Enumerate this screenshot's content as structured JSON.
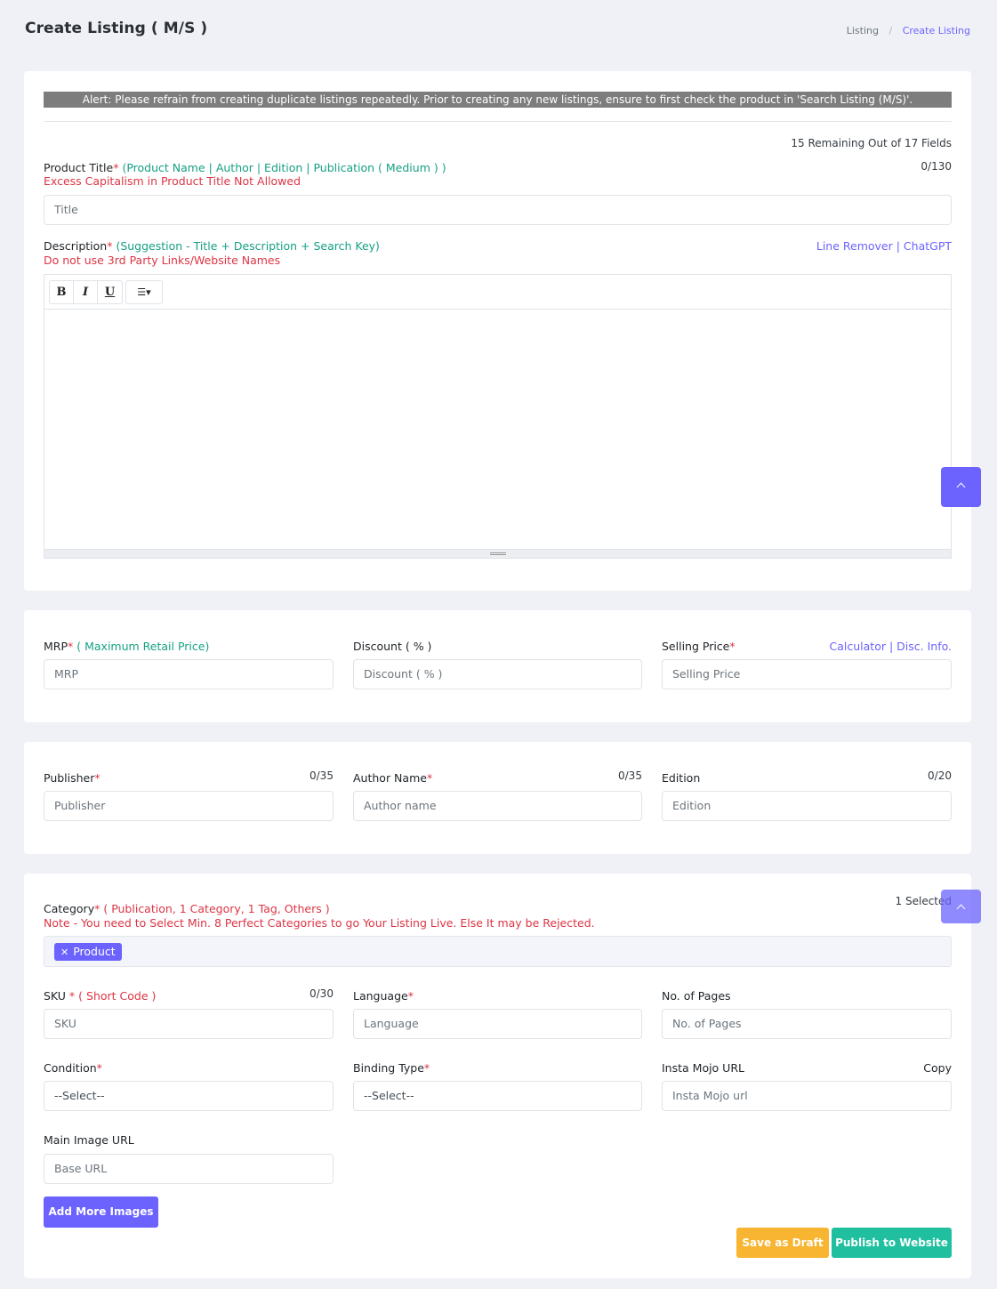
{
  "header": {
    "title": "Create Listing ( M/S )",
    "breadcrumb": [
      "Listing",
      "Create Listing"
    ]
  },
  "alert": "Alert: Please refrain from creating duplicate listings repeatedly. Prior to creating any new listings, ensure to first check the product in 'Search Listing (M/S)'.",
  "fields_remaining": "15 Remaining Out of 17 Fields",
  "product_title": {
    "label": "Product Title",
    "hint": "(Product Name | Author | Edition | Publication ( Medium ) )",
    "warning": "Excess Capitalism in Product Title Not Allowed",
    "counter": "0/130",
    "placeholder": "Title"
  },
  "description": {
    "label": "Description",
    "hint": "(Suggestion - Title + Description + Search Key)",
    "warning": "Do not use 3rd Party Links/Website Names",
    "links": "Line Remover | ChatGPT",
    "toolbar": {
      "bold": "B",
      "italic": "I",
      "underline": "U",
      "list": "☰▾"
    }
  },
  "pricing": {
    "mrp_label": "MRP",
    "mrp_hint": "( Maximum Retail Price)",
    "mrp_placeholder": "MRP",
    "discount_label": "Discount ( % )",
    "discount_placeholder": "Discount ( % )",
    "selling_label": "Selling Price",
    "selling_placeholder": "Selling Price",
    "links": "Calculator | Disc. Info."
  },
  "publisher": {
    "publisher_label": "Publisher",
    "publisher_counter": "0/35",
    "publisher_placeholder": "Publisher",
    "author_label": "Author Name",
    "author_counter": "0/35",
    "author_placeholder": "Author name",
    "edition_label": "Edition",
    "edition_counter": "0/20",
    "edition_placeholder": "Edition"
  },
  "category": {
    "label": "Category",
    "hint": "( Publication, 1 Category, 1 Tag, Others )",
    "note": "Note - You need to Select Min. 8 Perfect Categories to go Your Listing Live. Else It may be Rejected.",
    "selected": "1 Selected",
    "tags": [
      "Product"
    ]
  },
  "details": {
    "sku_label": "SKU ",
    "sku_hint": "( Short Code )",
    "sku_counter": "0/30",
    "sku_placeholder": "SKU",
    "language_label": "Language",
    "language_placeholder": "Language",
    "pages_label": "No. of Pages",
    "pages_placeholder": "No. of Pages",
    "condition_label": "Condition",
    "condition_value": "--Select--",
    "binding_label": "Binding Type",
    "binding_value": "--Select--",
    "instamojo_label": "Insta Mojo URL",
    "instamojo_copy": "Copy",
    "instamojo_placeholder": "Insta Mojo url",
    "image_label": "Main Image URL",
    "image_placeholder": "Base URL"
  },
  "buttons": {
    "add_images": "Add More Images",
    "save_draft": "Save as Draft",
    "publish": "Publish to Website"
  },
  "required_mark": "*",
  "colors": {
    "accent": "#6c63ff",
    "hint_green": "#16a085",
    "danger": "#dc3545",
    "warning": "#f7b531",
    "success": "#1fbf9f"
  }
}
